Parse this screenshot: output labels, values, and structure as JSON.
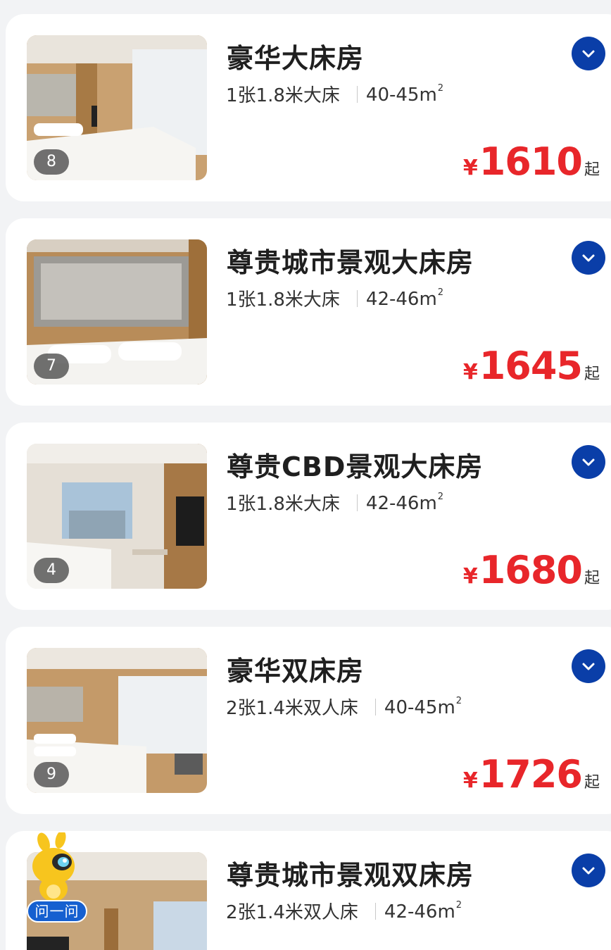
{
  "rooms": [
    {
      "name": "豪华大床房",
      "bed": "1张1.8米大床",
      "area": "40-45m",
      "area_sup": "2",
      "photo_count": "8",
      "currency": "¥",
      "price": "1610",
      "price_suffix": "起"
    },
    {
      "name": "尊贵城市景观大床房",
      "bed": "1张1.8米大床",
      "area": "42-46m",
      "area_sup": "2",
      "photo_count": "7",
      "currency": "¥",
      "price": "1645",
      "price_suffix": "起"
    },
    {
      "name": "尊贵CBD景观大床房",
      "bed": "1张1.8米大床",
      "area": "42-46m",
      "area_sup": "2",
      "photo_count": "4",
      "currency": "¥",
      "price": "1680",
      "price_suffix": "起"
    },
    {
      "name": "豪华双床房",
      "bed": "2张1.4米双人床",
      "area": "40-45m",
      "area_sup": "2",
      "photo_count": "9",
      "currency": "¥",
      "price": "1726",
      "price_suffix": "起"
    },
    {
      "name": "尊贵城市景观双床房",
      "bed": "2张1.4米双人床",
      "area": "42-46m",
      "area_sup": "2"
    }
  ],
  "assistant": {
    "label": "问一问"
  },
  "colors": {
    "accent_blue": "#0a3ea8",
    "price_red": "#e8262a",
    "page_bg": "#f2f3f5"
  },
  "icons": {
    "expand": "chevron-down-icon",
    "assistant": "mascot-icon"
  }
}
